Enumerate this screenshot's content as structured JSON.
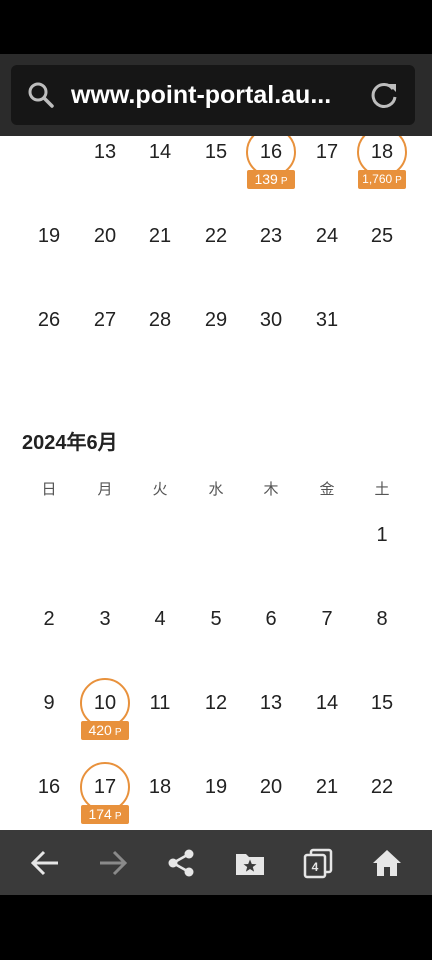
{
  "browser": {
    "url": "www.point-portal.au..."
  },
  "may_rows": [
    {
      "cells": [
        {
          "day": "13",
          "col": 1
        },
        {
          "day": "14",
          "col": 2
        },
        {
          "day": "15",
          "col": 3
        },
        {
          "day": "16",
          "col": 4,
          "circled": true,
          "points": "139"
        },
        {
          "day": "17",
          "col": 5
        },
        {
          "day": "18",
          "col": 6,
          "circled": true,
          "points": "1,760"
        }
      ]
    },
    {
      "cells": [
        {
          "day": "19",
          "col": 0
        },
        {
          "day": "20",
          "col": 1
        },
        {
          "day": "21",
          "col": 2
        },
        {
          "day": "22",
          "col": 3
        },
        {
          "day": "23",
          "col": 4
        },
        {
          "day": "24",
          "col": 5
        },
        {
          "day": "25",
          "col": 6
        }
      ]
    },
    {
      "cells": [
        {
          "day": "26",
          "col": 0
        },
        {
          "day": "27",
          "col": 1
        },
        {
          "day": "28",
          "col": 2
        },
        {
          "day": "29",
          "col": 3
        },
        {
          "day": "30",
          "col": 4
        },
        {
          "day": "31",
          "col": 5
        }
      ]
    }
  ],
  "june": {
    "title": "2024年6月",
    "weekdays": [
      "日",
      "月",
      "火",
      "水",
      "木",
      "金",
      "土"
    ],
    "rows": [
      {
        "cells": [
          {
            "day": "1",
            "col": 6
          }
        ]
      },
      {
        "cells": [
          {
            "day": "2",
            "col": 0
          },
          {
            "day": "3",
            "col": 1
          },
          {
            "day": "4",
            "col": 2
          },
          {
            "day": "5",
            "col": 3
          },
          {
            "day": "6",
            "col": 4
          },
          {
            "day": "7",
            "col": 5
          },
          {
            "day": "8",
            "col": 6
          }
        ]
      },
      {
        "cells": [
          {
            "day": "9",
            "col": 0
          },
          {
            "day": "10",
            "col": 1,
            "circled": true,
            "points": "420"
          },
          {
            "day": "11",
            "col": 2
          },
          {
            "day": "12",
            "col": 3
          },
          {
            "day": "13",
            "col": 4
          },
          {
            "day": "14",
            "col": 5
          },
          {
            "day": "15",
            "col": 6
          }
        ]
      },
      {
        "cells": [
          {
            "day": "16",
            "col": 0
          },
          {
            "day": "17",
            "col": 1,
            "circled": true,
            "points": "174"
          },
          {
            "day": "18",
            "col": 2
          },
          {
            "day": "19",
            "col": 3
          },
          {
            "day": "20",
            "col": 4
          },
          {
            "day": "21",
            "col": 5
          },
          {
            "day": "22",
            "col": 6
          }
        ]
      }
    ]
  },
  "point_unit": "P",
  "bottom_nav": [
    {
      "name": "back-button",
      "icon": "arrow-left-icon",
      "enabled": true
    },
    {
      "name": "forward-button",
      "icon": "arrow-right-icon",
      "enabled": false
    },
    {
      "name": "share-button",
      "icon": "share-icon",
      "enabled": true
    },
    {
      "name": "bookmarks-button",
      "icon": "bookmark-folder-icon",
      "enabled": true
    },
    {
      "name": "tabs-button",
      "icon": "tabs-icon",
      "tab_count": "4",
      "enabled": true
    },
    {
      "name": "home-button",
      "icon": "home-icon",
      "enabled": true
    }
  ],
  "colors": {
    "accent": "#e8913c",
    "nav_bg": "#3a3a3a",
    "urlbar_bg": "#2b2b2b"
  }
}
